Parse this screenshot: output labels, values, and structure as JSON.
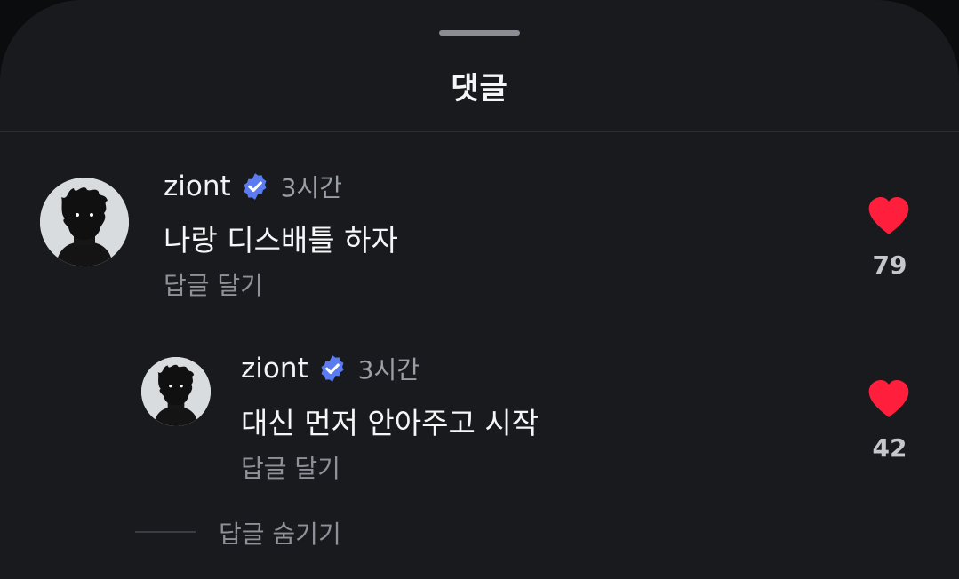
{
  "sheet": {
    "title": "댓글"
  },
  "comments": [
    {
      "username": "ziont",
      "time": "3시간",
      "text": "나랑 디스배틀 하자",
      "reply_label": "답글 달기",
      "likes": "79",
      "liked": true
    }
  ],
  "replies": [
    {
      "username": "ziont",
      "time": "3시간",
      "text": "대신 먼저 안아주고 시작",
      "reply_label": "답글 달기",
      "likes": "42",
      "liked": true
    }
  ],
  "hide_replies_label": "답글 숨기기",
  "colors": {
    "heart": "#ff1f3d",
    "verified": "#5b7cf0",
    "background": "#181a1e"
  },
  "icons": {
    "verified": "verified-badge-icon",
    "like": "heart-icon"
  }
}
